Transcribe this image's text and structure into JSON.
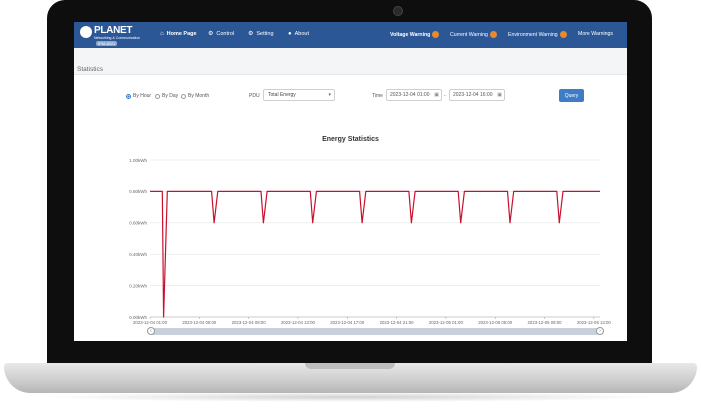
{
  "nav": {
    "logo": {
      "brand": "PLANET",
      "tagline": "Networking & Communication",
      "model": "IPM-8221"
    },
    "items": [
      {
        "label": "Home Page",
        "icon": "home-icon",
        "active": true
      },
      {
        "label": "Control",
        "icon": "control-icon",
        "active": false
      },
      {
        "label": "Setting",
        "icon": "gear-icon",
        "active": false
      },
      {
        "label": "About",
        "icon": "info-icon",
        "active": false
      }
    ],
    "warnings": [
      {
        "label": "Voltage Warning"
      },
      {
        "label": "Current Warning"
      },
      {
        "label": "Environment Warning"
      }
    ],
    "more_warnings": "More Warnings"
  },
  "section": {
    "title": "Statistics"
  },
  "filters": {
    "period_options": [
      "By Hour",
      "By Day",
      "By Month"
    ],
    "selected_period": "By Hour",
    "pdu_label": "PDU",
    "pdu_value": "Total Energy",
    "time_label": "Time",
    "start_time": "2023-12-04 01:00",
    "time_separator": "-",
    "end_time": "2023-12-04 16:00",
    "query_label": "Query"
  },
  "colors": {
    "nav_bg": "#2b5797",
    "accent": "#3f7cc6",
    "series": "#c8102e",
    "warning_badge": "#e88a2a"
  },
  "chart_data": {
    "type": "line",
    "title": "Energy Statistics",
    "xlabel": "",
    "ylabel": "",
    "ylim": [
      0,
      1
    ],
    "y_ticks": [
      "0.00kWh",
      "0.20kWh",
      "0.40kWh",
      "0.60kWh",
      "0.80kWh",
      "1.00kWh"
    ],
    "y_tick_values": [
      0,
      0.2,
      0.4,
      0.6,
      0.8,
      1.0
    ],
    "x_ticks": [
      "2023-12-04 01:00",
      "2023-12-04 05:00",
      "2023-12-04 09:00",
      "2023-12-04 13:00",
      "2023-12-04 17:00",
      "2023-12-04 21:00",
      "2023-12-05 01:00",
      "2023-12-05 05:00",
      "2023-12-05 09:00",
      "2023-12-05 13:00"
    ],
    "grid": "horizontal",
    "series": [
      {
        "x_hours": [
          0,
          1,
          1.1,
          1.4,
          5,
          5.2,
          5.5,
          9,
          9.2,
          9.5,
          13,
          13.2,
          13.5,
          17,
          17.2,
          17.5,
          21,
          21.2,
          21.5,
          25,
          25.2,
          25.5,
          29,
          29.2,
          29.5,
          33,
          33.2,
          33.5,
          36.5
        ],
        "values": [
          0.8,
          0.8,
          0,
          0.8,
          0.8,
          0.6,
          0.8,
          0.8,
          0.6,
          0.8,
          0.8,
          0.6,
          0.8,
          0.8,
          0.6,
          0.8,
          0.8,
          0.6,
          0.8,
          0.8,
          0.6,
          0.8,
          0.8,
          0.6,
          0.8,
          0.8,
          0.6,
          0.8,
          0.8
        ]
      }
    ]
  }
}
